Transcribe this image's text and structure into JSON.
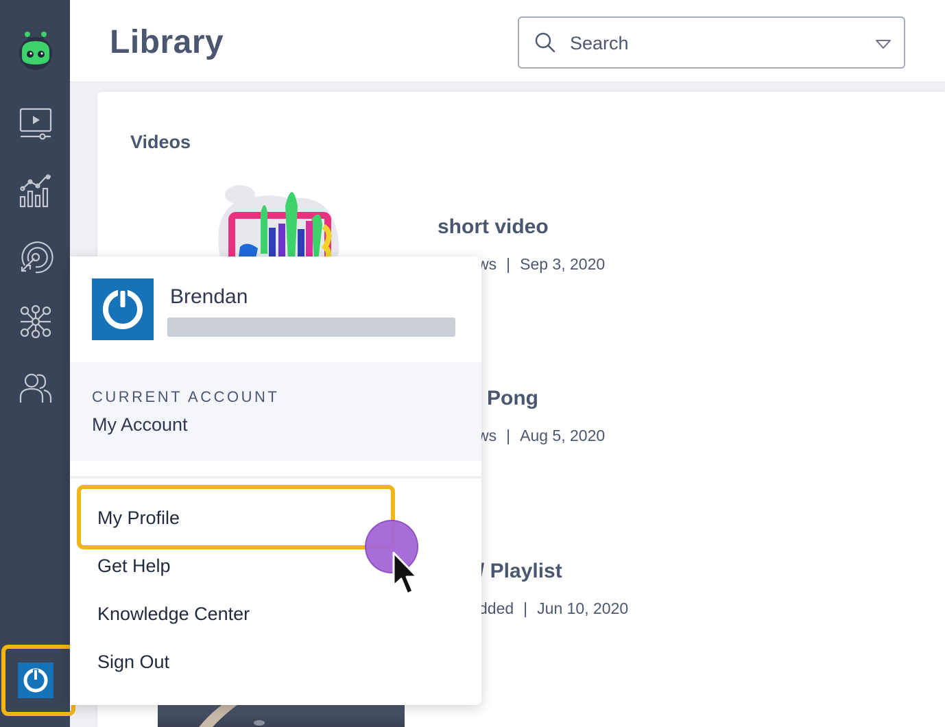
{
  "header": {
    "title": "Library",
    "search_placeholder": "Search"
  },
  "library": {
    "section_title": "Videos",
    "videos": [
      {
        "title": "short video",
        "stat_partial": "ws",
        "date": "Sep 3, 2020"
      },
      {
        "title_partial": "Pong",
        "stat_partial": "ws",
        "date": "Aug 5, 2020"
      },
      {
        "title_partial": "Playlist",
        "stat_partial": "dded",
        "date": "Jun 10, 2020"
      }
    ]
  },
  "menu": {
    "user_name": "Brendan",
    "account_label": "CURRENT ACCOUNT",
    "account_name": "My Account",
    "items": [
      {
        "label": "My Profile",
        "highlighted": true
      },
      {
        "label": "Get Help"
      },
      {
        "label": "Knowledge Center"
      },
      {
        "label": "Sign Out"
      }
    ]
  },
  "sidebar": {
    "items": [
      {
        "icon": "robot-logo-icon"
      },
      {
        "icon": "video-player-icon"
      },
      {
        "icon": "analytics-chart-icon"
      },
      {
        "icon": "target-icon"
      },
      {
        "icon": "integrations-network-icon"
      },
      {
        "icon": "users-icon"
      },
      {
        "icon": "power-account-icon"
      }
    ]
  },
  "colors": {
    "sidebar_bg": "#3a4458",
    "accent_blue": "#1673b8",
    "highlight_yellow": "#f2b516",
    "click_purple": "#a566d6",
    "logo_green": "#3dd26b"
  }
}
